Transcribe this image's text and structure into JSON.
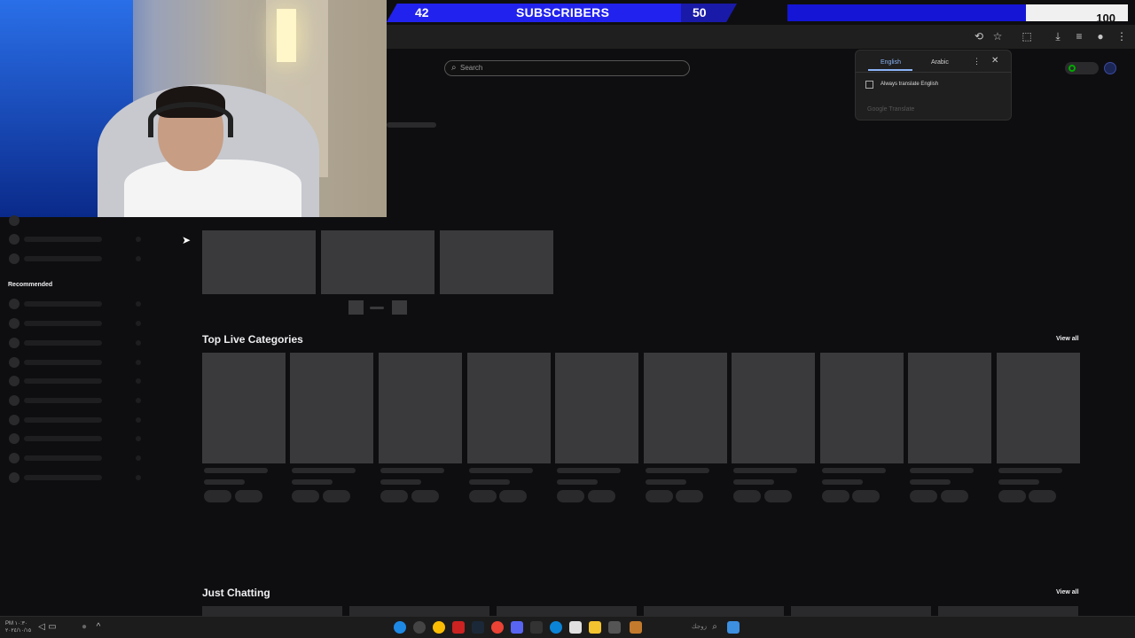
{
  "overlay": {
    "subscribers_current": "42",
    "subscribers_label": "SUBSCRIBERS",
    "subscribers_goal": "50",
    "subscribers_progress": 0.84,
    "secondary_goal": "100",
    "secondary_progress": 0.7
  },
  "search": {
    "placeholder": "Search"
  },
  "translate_popup": {
    "tab_english": "English",
    "tab_arabic": "Arabic",
    "checkbox_label": "Always translate English",
    "brand": "Google Translate"
  },
  "sidebar": {
    "recommended_title": "Recommended"
  },
  "sections": {
    "top_live": {
      "title": "Top Live Categories",
      "view_all": "View all"
    },
    "just_chatting": {
      "title": "Just Chatting",
      "view_all": "View all"
    }
  },
  "taskbar": {
    "time": "PM ١٠:٣٠",
    "date": "٢٠٢٤/١٠/١٥",
    "arabic_text": "زوجك"
  },
  "colors": {
    "subscriber_bar": "#2222ee",
    "page_bg": "#0e0e10",
    "skeleton": "#3a3a3d"
  }
}
